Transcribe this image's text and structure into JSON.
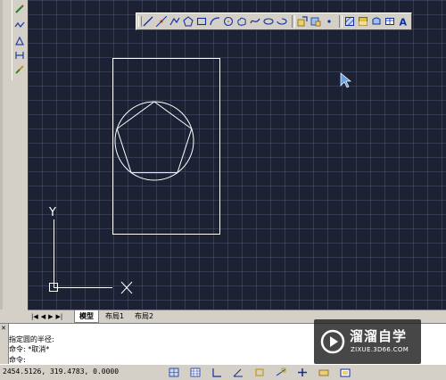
{
  "tabs": {
    "model": "模型",
    "layout1": "布局1",
    "layout2": "布局2"
  },
  "command": {
    "line1": "指定圆的半径:",
    "line2": "命令: *取消*",
    "line3": "命令:"
  },
  "status": {
    "coordinates": "2454.5126, 319.4783, 0.0000"
  },
  "canvas": {
    "ucs_y_label": "Y",
    "ucs_x_label": "X"
  },
  "draw_toolbar_icons": [
    "line-icon",
    "construction-line-icon",
    "polyline-icon",
    "polygon-icon",
    "rectangle-icon",
    "arc-icon",
    "circle-icon",
    "revision-cloud-icon",
    "spline-icon",
    "ellipse-icon",
    "ellipse-arc-icon",
    "insert-block-icon",
    "make-block-icon",
    "point-icon",
    "hatch-icon",
    "gradient-icon",
    "region-icon",
    "table-icon",
    "multiline-text-icon"
  ],
  "watermark": {
    "brand": "溜溜自学",
    "url": "ZIXUE.3D66.COM"
  },
  "colors": {
    "canvas_bg": "#1c2133",
    "drawing_lines": "#ffffff",
    "toolbar_bg": "#d4d0c8"
  }
}
